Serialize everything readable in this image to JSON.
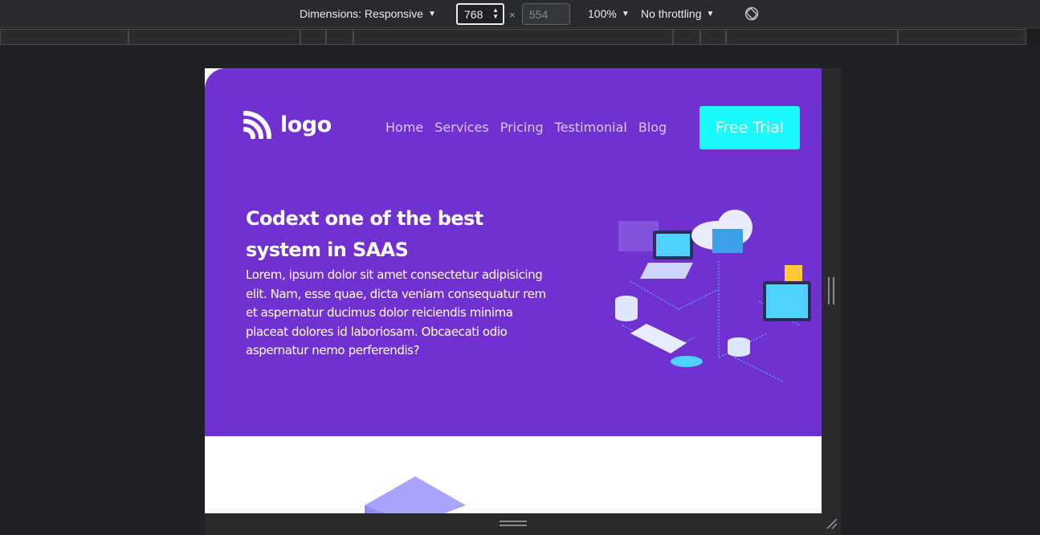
{
  "devtools": {
    "dimensions_label": "Dimensions: Responsive",
    "width_value": "768",
    "height_placeholder": "554",
    "times": "×",
    "zoom": "100%",
    "throttling": "No throttling"
  },
  "site": {
    "logo_text": "logo",
    "nav": [
      "Home",
      "Services",
      "Pricing",
      "Testimonial",
      "Blog"
    ],
    "cta_label": "Free Trial",
    "hero_title": "Codext one of the best system in SAAS",
    "hero_text": "Lorem, ipsum dolor sit amet consectetur adipisicing elit. Nam, esse quae, dicta veniam consequatur rem et aspernatur ducimus dolor reiciendis minima placeat dolores id laboriosam. Obcaecati odio aspernatur nemo perferendis?"
  },
  "colors": {
    "hero_bg": "#7031d0",
    "cta_bg": "#19fbff",
    "devtools_bg": "#292a2d"
  },
  "icons": {
    "logo": "wifi-arcs-logo-icon",
    "rotate": "rotate-icon",
    "resize": "resize-corner-icon",
    "illustration": "cloud-server-network-illustration"
  }
}
